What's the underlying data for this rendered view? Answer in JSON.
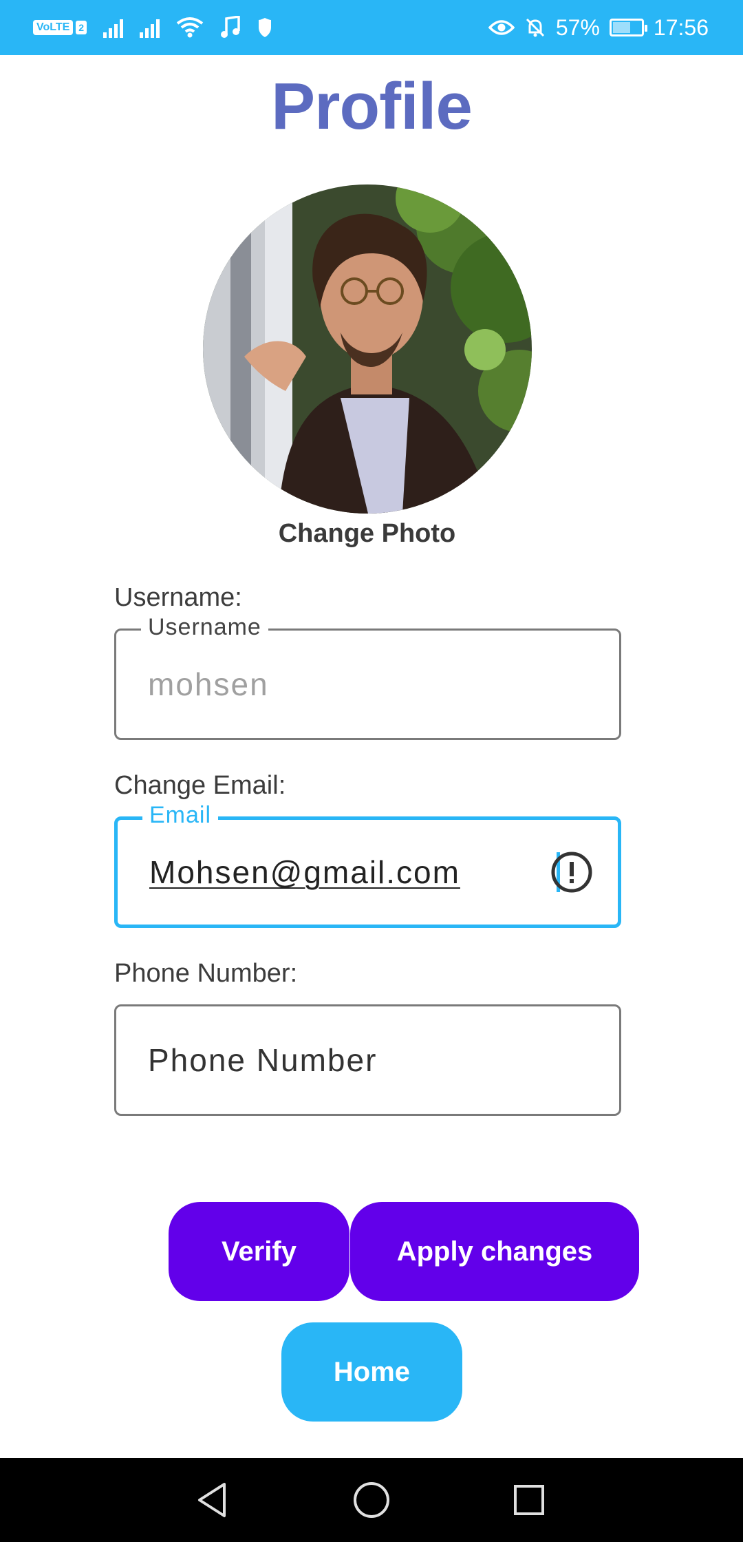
{
  "status_bar": {
    "volte": "VoLTE",
    "sim": "2",
    "battery_percent": "57%",
    "time": "17:56",
    "battery_level": 0.57,
    "icons": [
      "signal-icon",
      "wifi-icon",
      "music-icon",
      "shield-icon",
      "eye-icon",
      "bell-off-icon",
      "battery-charging-icon"
    ]
  },
  "header": {
    "title": "Profile"
  },
  "profile": {
    "change_photo": "Change Photo"
  },
  "form": {
    "username": {
      "label": "Username:",
      "floating": "Username",
      "value": "mohsen"
    },
    "email": {
      "label": "Change Email:",
      "floating": "Email",
      "value": "Mohsen@gmail.com"
    },
    "phone": {
      "label": "Phone Number:",
      "placeholder": "Phone Number"
    }
  },
  "actions": {
    "verify": "Verify",
    "apply": "Apply changes",
    "home": "Home"
  },
  "nav": {
    "icons": [
      "back-icon",
      "home-circle-icon",
      "recents-icon"
    ]
  },
  "colors": {
    "status_bar": "#29b6f6",
    "title": "#5c6bc0",
    "primary": "#6200ea",
    "accent": "#29b6f6"
  }
}
